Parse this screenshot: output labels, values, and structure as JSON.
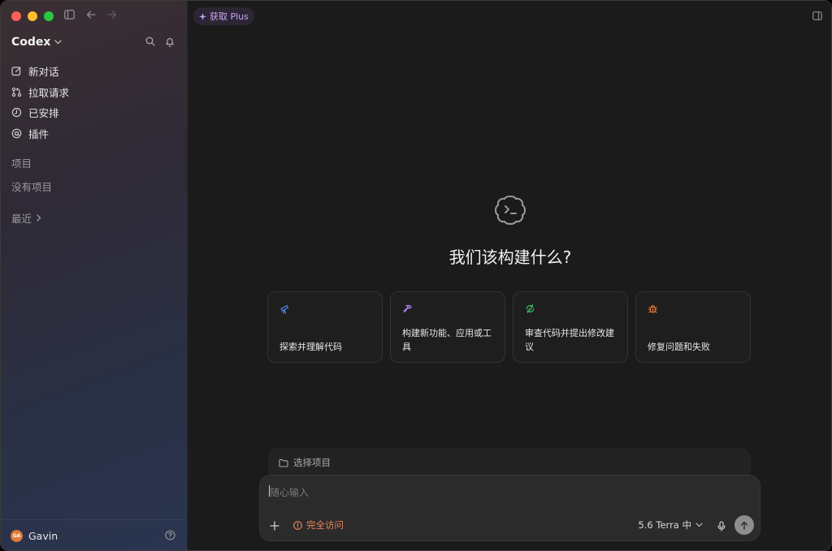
{
  "sidebar": {
    "brand": "Codex",
    "nav": [
      {
        "label": "新对话",
        "icon": "compose-icon"
      },
      {
        "label": "拉取请求",
        "icon": "pull-request-icon"
      },
      {
        "label": "已安排",
        "icon": "clock-icon"
      },
      {
        "label": "插件",
        "icon": "at-icon"
      }
    ],
    "projects_label": "项目",
    "no_projects": "没有项目",
    "recent_label": "最近",
    "user": {
      "initials": "GA",
      "name": "Gavin"
    }
  },
  "main": {
    "upgrade_label": "获取 Plus",
    "hero_title": "我们该构建什么?",
    "cards": [
      {
        "text": "探索并理解代码",
        "icon": "telescope-icon",
        "color": "#4a8cf0"
      },
      {
        "text": "构建新功能、应用或工具",
        "icon": "hammer-icon",
        "color": "#b27cf0"
      },
      {
        "text": "审查代码并提出修改建议",
        "icon": "review-icon",
        "color": "#3cc06a"
      },
      {
        "text": "修复问题和失败",
        "icon": "bug-icon",
        "color": "#e8753e"
      }
    ],
    "project_select": "选择项目",
    "composer": {
      "placeholder": "随心输入",
      "access_label": "完全访问",
      "model_label": "5.6 Terra 中"
    }
  },
  "colors": {
    "accent_purple": "#c8a6f5",
    "warning_orange": "#e8865a"
  }
}
